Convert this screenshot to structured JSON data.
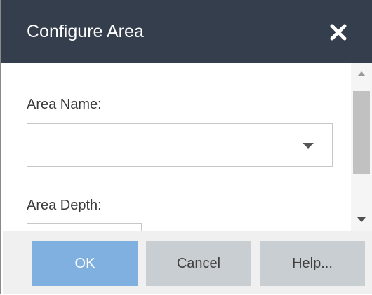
{
  "dialog": {
    "title": "Configure Area",
    "close_icon": "close-x-icon",
    "colors": {
      "titlebar": "#353e4c",
      "primary_button": "#7fb0e0",
      "secondary_button": "#c9ced3"
    }
  },
  "form": {
    "area_name_label": "Area Name:",
    "area_name_value": "",
    "area_depth_label": "Area Depth:",
    "area_depth_value": ""
  },
  "buttons": {
    "ok": "OK",
    "cancel": "Cancel",
    "help": "Help..."
  }
}
